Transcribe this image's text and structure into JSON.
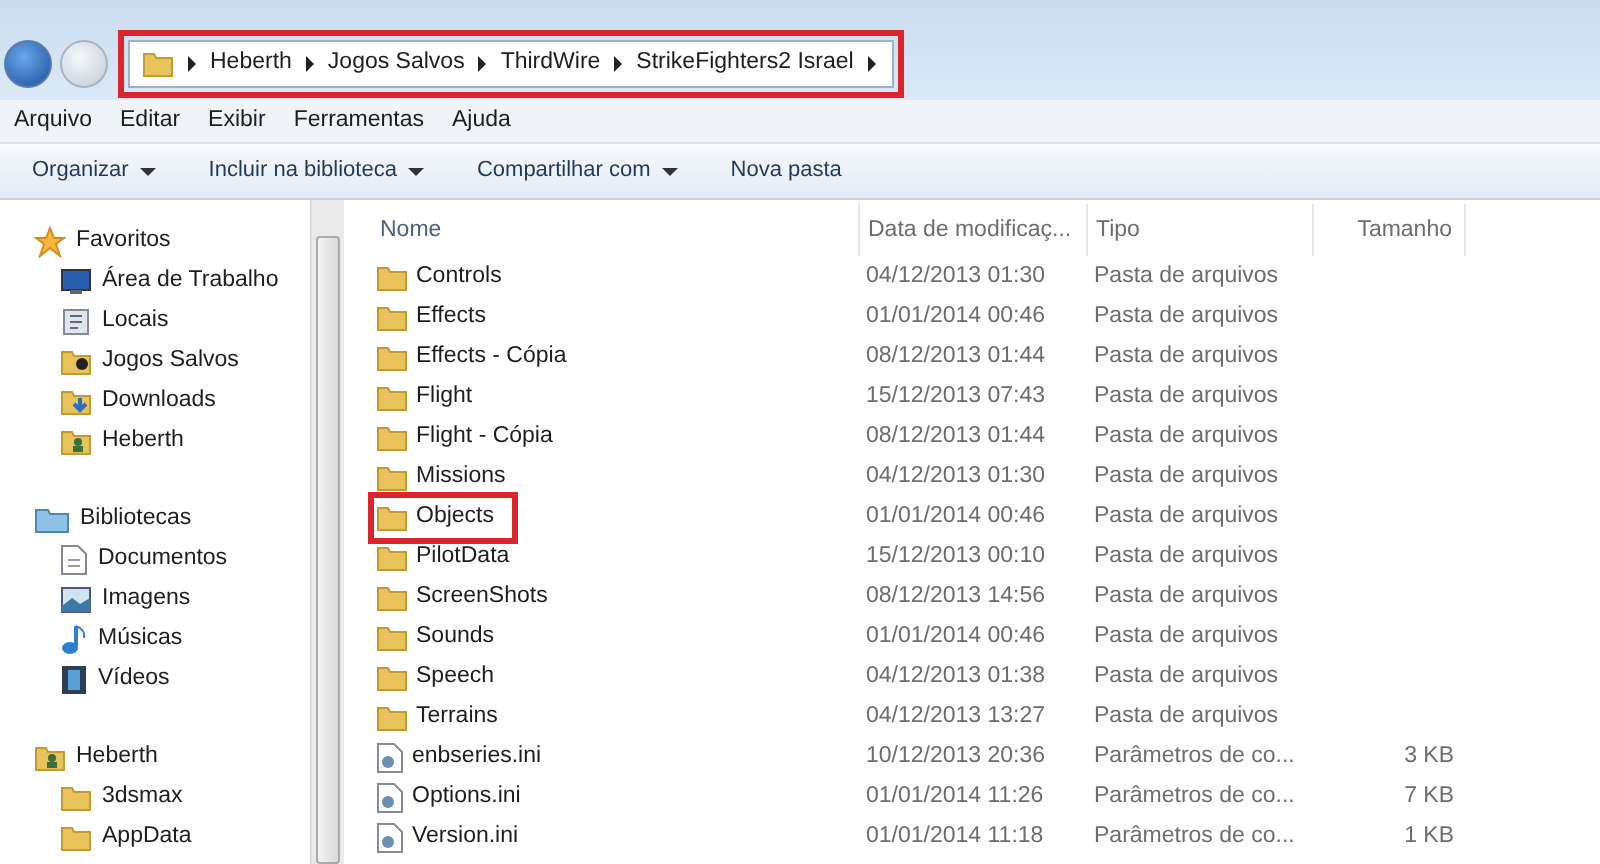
{
  "address_bar": {
    "highlighted": true,
    "crumbs": [
      "Heberth",
      "Jogos Salvos",
      "ThirdWire",
      "StrikeFighters2 Israel"
    ]
  },
  "menu_bar": [
    "Arquivo",
    "Editar",
    "Exibir",
    "Ferramentas",
    "Ajuda"
  ],
  "toolbar": [
    {
      "label": "Organizar",
      "dropdown": true
    },
    {
      "label": "Incluir na biblioteca",
      "dropdown": true
    },
    {
      "label": "Compartilhar com",
      "dropdown": true
    },
    {
      "label": "Nova pasta",
      "dropdown": false
    }
  ],
  "sidebar": {
    "groups": [
      {
        "label": "Favoritos",
        "children": [
          "Área de Trabalho",
          "Locais",
          "Jogos Salvos",
          "Downloads",
          "Heberth"
        ]
      },
      {
        "label": "Bibliotecas",
        "children": [
          "Documentos",
          "Imagens",
          "Músicas",
          "Vídeos"
        ]
      },
      {
        "label": "Heberth",
        "children": [
          "3dsmax",
          "AppData"
        ]
      }
    ]
  },
  "table": {
    "columns": [
      "Nome",
      "Data de modificaç...",
      "Tipo",
      "Tamanho"
    ],
    "rows": [
      {
        "kind": "folder",
        "name": "Controls",
        "date": "04/12/2013 01:30",
        "type": "Pasta de arquivos",
        "size": "",
        "highlighted": false
      },
      {
        "kind": "folder",
        "name": "Effects",
        "date": "01/01/2014 00:46",
        "type": "Pasta de arquivos",
        "size": "",
        "highlighted": false
      },
      {
        "kind": "folder",
        "name": "Effects - Cópia",
        "date": "08/12/2013 01:44",
        "type": "Pasta de arquivos",
        "size": "",
        "highlighted": false
      },
      {
        "kind": "folder",
        "name": "Flight",
        "date": "15/12/2013 07:43",
        "type": "Pasta de arquivos",
        "size": "",
        "highlighted": false
      },
      {
        "kind": "folder",
        "name": "Flight - Cópia",
        "date": "08/12/2013 01:44",
        "type": "Pasta de arquivos",
        "size": "",
        "highlighted": false
      },
      {
        "kind": "folder",
        "name": "Missions",
        "date": "04/12/2013 01:30",
        "type": "Pasta de arquivos",
        "size": "",
        "highlighted": false
      },
      {
        "kind": "folder",
        "name": "Objects",
        "date": "01/01/2014 00:46",
        "type": "Pasta de arquivos",
        "size": "",
        "highlighted": true
      },
      {
        "kind": "folder",
        "name": "PilotData",
        "date": "15/12/2013 00:10",
        "type": "Pasta de arquivos",
        "size": "",
        "highlighted": false
      },
      {
        "kind": "folder",
        "name": "ScreenShots",
        "date": "08/12/2013 14:56",
        "type": "Pasta de arquivos",
        "size": "",
        "highlighted": false
      },
      {
        "kind": "folder",
        "name": "Sounds",
        "date": "01/01/2014 00:46",
        "type": "Pasta de arquivos",
        "size": "",
        "highlighted": false
      },
      {
        "kind": "folder",
        "name": "Speech",
        "date": "04/12/2013 01:38",
        "type": "Pasta de arquivos",
        "size": "",
        "highlighted": false
      },
      {
        "kind": "folder",
        "name": "Terrains",
        "date": "04/12/2013 13:27",
        "type": "Pasta de arquivos",
        "size": "",
        "highlighted": false
      },
      {
        "kind": "file",
        "name": "enbseries.ini",
        "date": "10/12/2013 20:36",
        "type": "Parâmetros de co...",
        "size": "3 KB",
        "highlighted": false
      },
      {
        "kind": "file",
        "name": "Options.ini",
        "date": "01/01/2014 11:26",
        "type": "Parâmetros de co...",
        "size": "7 KB",
        "highlighted": false
      },
      {
        "kind": "file",
        "name": "Version.ini",
        "date": "01/01/2014 11:18",
        "type": "Parâmetros de co...",
        "size": "1 KB",
        "highlighted": false
      }
    ]
  }
}
